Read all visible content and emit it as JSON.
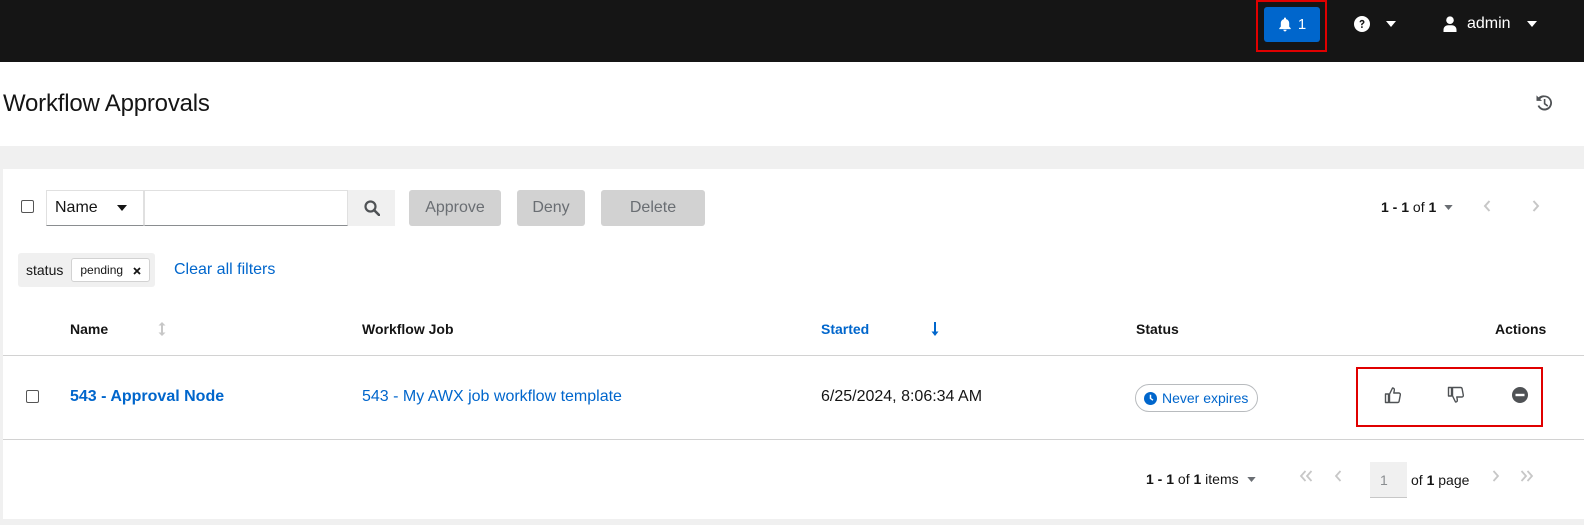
{
  "topbar": {
    "notifications_count": "1",
    "user_name": "admin"
  },
  "page": {
    "title": "Workflow Approvals"
  },
  "toolbar": {
    "filter_field": "Name",
    "search_placeholder": "",
    "approve_label": "Approve",
    "deny_label": "Deny",
    "delete_label": "Delete",
    "pager_range": "1 - 1",
    "pager_of": "of",
    "pager_total": "1"
  },
  "filters": {
    "category": "status",
    "chip": "pending",
    "clear_all": "Clear all filters"
  },
  "table": {
    "headers": {
      "name": "Name",
      "workflow_job": "Workflow Job",
      "started": "Started",
      "status": "Status",
      "actions": "Actions"
    },
    "rows": [
      {
        "name": "543 - Approval Node",
        "workflow_job": "543 - My AWX job workflow template",
        "started": "6/25/2024, 8:06:34 AM",
        "status": "Never expires"
      }
    ]
  },
  "bottom_pager": {
    "range": "1 - 1",
    "of_label": "of",
    "total": "1",
    "items_label": "items",
    "page_number": "1",
    "of_page_prefix": "of",
    "total_pages": "1",
    "page_label": "page"
  },
  "colors": {
    "accent": "#0066cc",
    "topbar": "#151515",
    "highlight": "#e00000"
  }
}
